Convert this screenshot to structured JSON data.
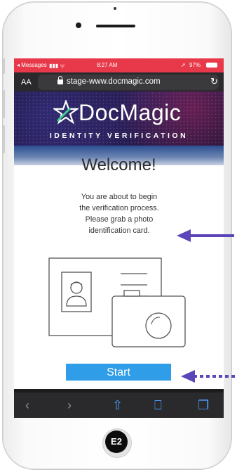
{
  "status": {
    "carrier": "◂ Messages",
    "time": "8:27 AM",
    "battery": "97%"
  },
  "browser": {
    "text_size": "AA",
    "url": "stage-www.docmagic.com"
  },
  "brand": {
    "name": "DocMagic",
    "tagline": "IDENTITY VERIFICATION"
  },
  "content": {
    "title": "Welcome!",
    "message_lines": [
      "You are about to begin",
      "the verification process.",
      "Please grab a photo",
      "identification card."
    ],
    "start_label": "Start"
  },
  "annotations": {
    "badge": "E2"
  },
  "colors": {
    "accent": "#2f9de8",
    "arrow": "#5b45b8",
    "statusbar": "#e8394a"
  }
}
